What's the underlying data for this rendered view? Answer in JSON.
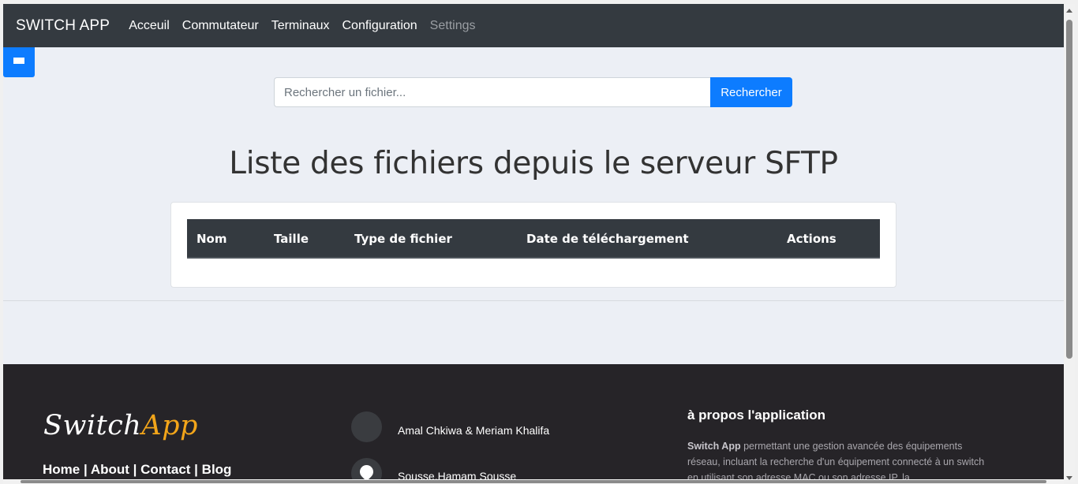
{
  "navbar": {
    "brand": "SWITCH APP",
    "links": [
      "Acceuil",
      "Commutateur",
      "Terminaux",
      "Configuration"
    ],
    "disabled_link": "Settings"
  },
  "sidebar_toggle": {
    "icon": "hamburger-icon"
  },
  "search": {
    "placeholder": "Rechercher un fichier...",
    "value": "",
    "button_label": "Rechercher"
  },
  "main": {
    "title": "Liste des fichiers depuis le serveur SFTP",
    "table": {
      "columns": [
        "Nom",
        "Taille",
        "Type de fichier",
        "Date de téléchargement",
        "Actions"
      ],
      "rows": []
    }
  },
  "footer": {
    "logo_part1": "Switch",
    "logo_part2": "App",
    "links": [
      "Home",
      "About",
      "Contact",
      "Blog"
    ],
    "separator": "|",
    "authors": "Amal Chkiwa & Meriam Khalifa",
    "location": "Sousse,Hamam Sousse",
    "about_title": "à propos l'application",
    "about_bold": "Switch App",
    "about_text": " permettant une gestion avancée des équipements réseau, incluant la recherche d'un équipement connecté à un switch en utilisant son adresse MAC ou son adresse IP, la"
  },
  "colors": {
    "navbar_bg": "#343a40",
    "primary": "#0d7cff",
    "footer_bg": "#262428",
    "logo_accent": "#f2a51a"
  }
}
